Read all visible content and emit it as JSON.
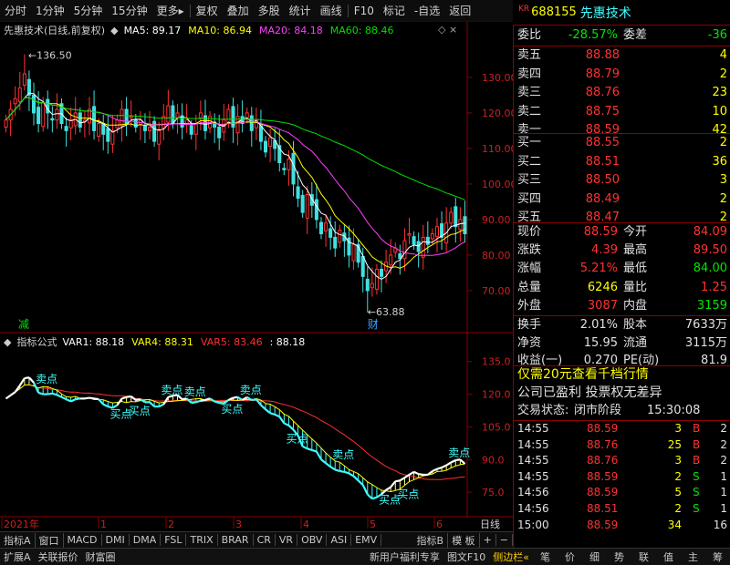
{
  "toolbar": {
    "items": [
      "分时",
      "1分钟",
      "5分钟",
      "15分钟",
      "更多",
      "复权",
      "叠加",
      "多股",
      "统计",
      "画线",
      "F10",
      "标记",
      "-自选",
      "返回"
    ]
  },
  "stock": {
    "prefix": "KR",
    "code": "688155",
    "name": "先惠技术"
  },
  "main_legend": {
    "title": "先惠技术(日线,前复权)",
    "ma": [
      {
        "label": "MA5:",
        "value": "89.17",
        "color": "#ffffff"
      },
      {
        "label": "MA10:",
        "value": "86.94",
        "color": "#ffff00"
      },
      {
        "label": "MA20:",
        "value": "84.18",
        "color": "#ff40ff"
      },
      {
        "label": "MA60:",
        "value": "88.46",
        "color": "#00e000"
      }
    ]
  },
  "sub_legend": {
    "title": "指标公式",
    "vars": [
      {
        "label": "VAR1:",
        "value": "88.18",
        "color": "#ffffff"
      },
      {
        "label": "VAR4:",
        "value": "88.31",
        "color": "#ffff00"
      },
      {
        "label": "VAR5:",
        "value": "83.46",
        "color": "#ff3030"
      },
      {
        "label": ":",
        "value": "88.18",
        "color": "#ffffff"
      }
    ]
  },
  "main_annot": {
    "high": "136.50",
    "low": "63.88",
    "jian": "减",
    "cai": "财"
  },
  "sub_annot": {
    "sell": "卖点",
    "buy": "买点"
  },
  "chart_data": [
    {
      "type": "candlestick",
      "y_ticks": [
        130,
        120,
        110,
        100,
        90,
        80,
        70
      ],
      "ylim": [
        61,
        141
      ],
      "ma_series": [
        "MA5",
        "MA10",
        "MA20",
        "MA60"
      ],
      "closes": [
        118,
        121,
        124,
        127,
        131,
        125,
        120,
        117,
        123,
        120,
        118,
        121,
        117,
        115,
        118,
        120,
        116,
        118,
        121,
        115,
        117,
        114,
        112,
        115,
        118,
        121,
        117,
        119,
        116,
        118,
        115,
        116,
        112,
        115,
        119,
        122,
        117,
        120,
        116,
        118,
        114,
        117,
        120,
        115,
        119,
        116,
        113,
        118,
        121,
        116,
        119,
        117,
        120,
        115,
        118,
        112,
        109,
        113,
        110,
        106,
        104,
        107,
        100,
        96,
        92,
        97,
        94,
        90,
        86,
        89,
        85,
        82,
        87,
        84,
        80,
        83,
        78,
        74,
        70,
        72,
        76,
        74,
        78,
        80,
        82,
        79,
        84,
        86,
        83,
        81,
        85,
        83,
        86,
        88,
        85,
        89,
        92,
        88,
        90,
        86
      ]
    },
    {
      "type": "line",
      "y_ticks": [
        135.0,
        120.0,
        105.0,
        90.0,
        75.0
      ],
      "ylim": [
        65,
        142
      ]
    }
  ],
  "x_axis": {
    "labels": [
      "2021年",
      "1",
      "2",
      "3",
      "4",
      "5",
      "6"
    ],
    "period": "日线"
  },
  "bottom_tabs": [
    "指标A",
    "窗口",
    "MACD",
    "DMI",
    "DMA",
    "FSL",
    "TRIX",
    "BRAR",
    "CR",
    "VR",
    "OBV",
    "ASI",
    "EMV"
  ],
  "bottom_tabs_right": [
    "指标B",
    "模 板",
    "+",
    "−"
  ],
  "quote": {
    "weibi_label": "委比",
    "weibi": "-28.57%",
    "weicha_label": "委差",
    "weicha": "-36",
    "asks": [
      {
        "label": "卖五",
        "price": "88.88",
        "vol": "4"
      },
      {
        "label": "卖四",
        "price": "88.79",
        "vol": "2"
      },
      {
        "label": "卖三",
        "price": "88.76",
        "vol": "23"
      },
      {
        "label": "卖二",
        "price": "88.75",
        "vol": "10"
      },
      {
        "label": "卖一",
        "price": "88.59",
        "vol": "42"
      }
    ],
    "bids": [
      {
        "label": "买一",
        "price": "88.55",
        "vol": "2"
      },
      {
        "label": "买二",
        "price": "88.51",
        "vol": "36"
      },
      {
        "label": "买三",
        "price": "88.50",
        "vol": "3"
      },
      {
        "label": "买四",
        "price": "88.49",
        "vol": "2"
      },
      {
        "label": "买五",
        "price": "88.47",
        "vol": "2"
      }
    ],
    "stats": [
      {
        "l1": "现价",
        "v1": "88.59",
        "c1": "red",
        "l2": "今开",
        "v2": "84.09",
        "c2": "red"
      },
      {
        "l1": "涨跌",
        "v1": "4.39",
        "c1": "red",
        "l2": "最高",
        "v2": "89.50",
        "c2": "red"
      },
      {
        "l1": "涨幅",
        "v1": "5.21%",
        "c1": "red",
        "l2": "最低",
        "v2": "84.00",
        "c2": "green"
      },
      {
        "l1": "总量",
        "v1": "6246",
        "c1": "yellow",
        "l2": "量比",
        "v2": "1.25",
        "c2": "red"
      },
      {
        "l1": "外盘",
        "v1": "3087",
        "c1": "red",
        "l2": "内盘",
        "v2": "3159",
        "c2": "green"
      }
    ],
    "stats2": [
      {
        "l1": "换手",
        "v1": "2.01%",
        "l2": "股本",
        "v2": "7633万"
      },
      {
        "l1": "净资",
        "v1": "15.95",
        "l2": "流通",
        "v2": "3115万"
      },
      {
        "l1": "收益(一)",
        "v1": "0.270",
        "l2": "PE(动)",
        "v2": "81.9"
      }
    ],
    "promo": "仅需20元查看千档行情",
    "info": "公司已盈利 投票权无差异",
    "trade_status_label": "交易状态:",
    "trade_status": "闭市阶段",
    "trade_time": "15:30:08"
  },
  "ticks": [
    {
      "time": "14:55",
      "price": "88.59",
      "vol": "3",
      "side": "B",
      "n": "2"
    },
    {
      "time": "14:55",
      "price": "88.76",
      "vol": "25",
      "side": "B",
      "n": "2"
    },
    {
      "time": "14:55",
      "price": "88.76",
      "vol": "3",
      "side": "B",
      "n": "2"
    },
    {
      "time": "14:55",
      "price": "88.59",
      "vol": "2",
      "side": "S",
      "n": "1"
    },
    {
      "time": "14:56",
      "price": "88.59",
      "vol": "5",
      "side": "S",
      "n": "1"
    },
    {
      "time": "14:56",
      "price": "88.51",
      "vol": "2",
      "side": "S",
      "n": "1"
    },
    {
      "time": "15:00",
      "price": "88.59",
      "vol": "34",
      "side": "",
      "n": "16"
    }
  ],
  "bottom_bar": [
    "扩展A",
    "关联报价",
    "财富圈",
    "新用户福利专享",
    "图文F10",
    "侧边栏«",
    "笔",
    "价",
    "细",
    "势",
    "联",
    "值",
    "主",
    "筹"
  ]
}
